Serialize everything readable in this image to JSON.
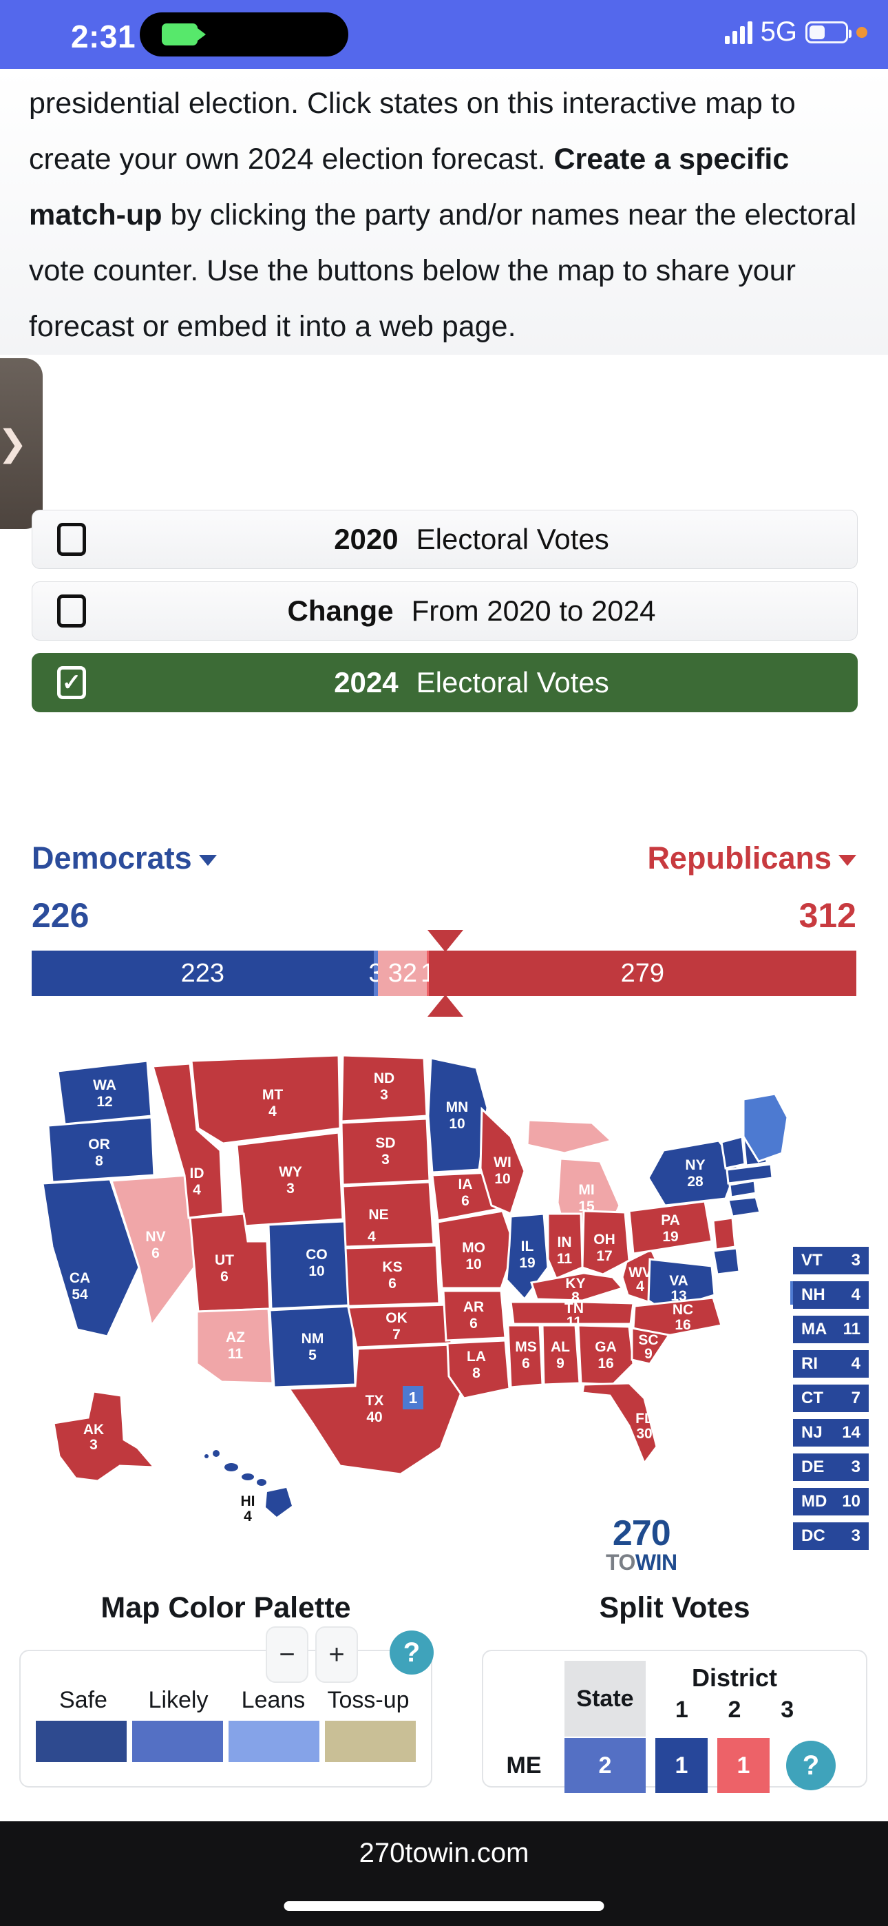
{
  "status_bar": {
    "time": "2:31",
    "network": "5G",
    "camera_icon": "video-camera-icon",
    "signal_icon": "cellular-bars-icon",
    "battery_icon": "battery-icon",
    "recording_dot_color": "#f09536",
    "background_color": "#5468ec"
  },
  "intro": {
    "paragraph_part1": "presidential election. Click states on this interactive map to create your own 2024 election forecast. ",
    "paragraph_bold": "Create a specific match-up",
    "paragraph_part2": " by clicking the party and/or names near the electoral vote counter. Use the buttons below the map to share your forecast or embed it into a web page."
  },
  "side_tab": {
    "icon": "chevron-right-icon",
    "glyph": "❯"
  },
  "toggles": [
    {
      "checked": false,
      "bold_label": "2020",
      "label": "Electoral Votes"
    },
    {
      "checked": false,
      "bold_label": "Change",
      "label": "From 2020 to 2024"
    },
    {
      "checked": true,
      "bold_label": "2024",
      "label": "Electoral Votes",
      "check_glyph": "✓"
    }
  ],
  "counter": {
    "dem_label": "Democrats",
    "rep_label": "Republicans",
    "dem_total": "226",
    "rep_total": "312",
    "dem_color": "#2b4c9b",
    "rep_color": "#c83a3f",
    "segments": [
      {
        "label": "223",
        "value": 223,
        "color": "#27479a"
      },
      {
        "label": "3",
        "value": 3,
        "color": "#5b7dd1"
      },
      {
        "label": "32",
        "value": 32,
        "color": "#f0a6a8"
      },
      {
        "label": "1",
        "value": 1,
        "color": "#ed6268"
      },
      {
        "label": "279",
        "value": 279,
        "color": "#c0393e"
      }
    ],
    "majority_marker": 270
  },
  "map": {
    "logo_line1": "270",
    "logo_to": "TO",
    "logo_win": "WIN",
    "colors": {
      "safe_dem": "#27479a",
      "likely_dem": "#4d7ad1",
      "leans_dem": "#85a3e8",
      "safe_rep": "#c0393e",
      "leans_rep": "#f0a6a8",
      "likely_rep": "#ed6268",
      "tossup": "#c9bf96"
    },
    "states": [
      {
        "abbr": "WA",
        "votes": "12",
        "party": "D"
      },
      {
        "abbr": "OR",
        "votes": "8",
        "party": "D"
      },
      {
        "abbr": "CA",
        "votes": "54",
        "party": "D"
      },
      {
        "abbr": "NV",
        "votes": "6",
        "party": "R-leans"
      },
      {
        "abbr": "ID",
        "votes": "4",
        "party": "R"
      },
      {
        "abbr": "MT",
        "votes": "4",
        "party": "R"
      },
      {
        "abbr": "WY",
        "votes": "3",
        "party": "R"
      },
      {
        "abbr": "UT",
        "votes": "6",
        "party": "R"
      },
      {
        "abbr": "AZ",
        "votes": "11",
        "party": "R-leans"
      },
      {
        "abbr": "NM",
        "votes": "5",
        "party": "D"
      },
      {
        "abbr": "CO",
        "votes": "10",
        "party": "D"
      },
      {
        "abbr": "ND",
        "votes": "3",
        "party": "R"
      },
      {
        "abbr": "SD",
        "votes": "3",
        "party": "R"
      },
      {
        "abbr": "NE",
        "votes": "4",
        "party": "R",
        "split_chip": "1",
        "split_party": "D"
      },
      {
        "abbr": "KS",
        "votes": "6",
        "party": "R"
      },
      {
        "abbr": "OK",
        "votes": "7",
        "party": "R"
      },
      {
        "abbr": "TX",
        "votes": "40",
        "party": "R"
      },
      {
        "abbr": "MN",
        "votes": "10",
        "party": "D"
      },
      {
        "abbr": "IA",
        "votes": "6",
        "party": "R"
      },
      {
        "abbr": "MO",
        "votes": "10",
        "party": "R"
      },
      {
        "abbr": "AR",
        "votes": "6",
        "party": "R"
      },
      {
        "abbr": "LA",
        "votes": "8",
        "party": "R"
      },
      {
        "abbr": "WI",
        "votes": "10",
        "party": "R"
      },
      {
        "abbr": "IL",
        "votes": "19",
        "party": "D"
      },
      {
        "abbr": "MI",
        "votes": "15",
        "party": "R-leans"
      },
      {
        "abbr": "IN",
        "votes": "11",
        "party": "R"
      },
      {
        "abbr": "OH",
        "votes": "17",
        "party": "R"
      },
      {
        "abbr": "KY",
        "votes": "8",
        "party": "R"
      },
      {
        "abbr": "TN",
        "votes": "11",
        "party": "R"
      },
      {
        "abbr": "MS",
        "votes": "6",
        "party": "R"
      },
      {
        "abbr": "AL",
        "votes": "9",
        "party": "R"
      },
      {
        "abbr": "GA",
        "votes": "16",
        "party": "R"
      },
      {
        "abbr": "SC",
        "votes": "9",
        "party": "R"
      },
      {
        "abbr": "NC",
        "votes": "16",
        "party": "R"
      },
      {
        "abbr": "FL",
        "votes": "30",
        "party": "R"
      },
      {
        "abbr": "WV",
        "votes": "4",
        "party": "R"
      },
      {
        "abbr": "VA",
        "votes": "13",
        "party": "D"
      },
      {
        "abbr": "PA",
        "votes": "19",
        "party": "R"
      },
      {
        "abbr": "NY",
        "votes": "28",
        "party": "D"
      },
      {
        "abbr": "ME",
        "votes": "",
        "party": "D-likely"
      },
      {
        "abbr": "AK",
        "votes": "3",
        "party": "R"
      },
      {
        "abbr": "HI",
        "votes": "4",
        "party": "D"
      }
    ],
    "me_chips": [
      {
        "label": "2",
        "color": "#4d7ad1"
      },
      {
        "label": "1",
        "color": "#ed6268"
      },
      {
        "label": "1",
        "color": "#27479a"
      }
    ],
    "me_label": "ME",
    "northeast_list": [
      {
        "abbr": "VT",
        "votes": "3"
      },
      {
        "abbr": "NH",
        "votes": "4"
      },
      {
        "abbr": "MA",
        "votes": "11"
      },
      {
        "abbr": "RI",
        "votes": "4"
      },
      {
        "abbr": "CT",
        "votes": "7"
      },
      {
        "abbr": "NJ",
        "votes": "14"
      },
      {
        "abbr": "DE",
        "votes": "3"
      },
      {
        "abbr": "MD",
        "votes": "10"
      },
      {
        "abbr": "DC",
        "votes": "3"
      }
    ]
  },
  "palette_panel": {
    "title": "Map Color Palette",
    "minus_label": "−",
    "plus_label": "+",
    "help_label": "?",
    "labels": [
      "Safe",
      "Likely",
      "Leans",
      "Toss-up"
    ],
    "swatches": [
      "#2e4a8f",
      "#5470c4",
      "#85a3e8",
      "#c9bf96"
    ]
  },
  "split_panel": {
    "title": "Split Votes",
    "state_header": "State",
    "district_header": "District",
    "district_numbers": [
      "1",
      "2",
      "3"
    ],
    "rows": [
      {
        "abbr": "ME",
        "state_value": "2",
        "state_color": "#5470c4",
        "districts": [
          {
            "value": "1",
            "color": "#27479a"
          },
          {
            "value": "1",
            "color": "#ed6268"
          },
          {
            "value": "?",
            "color": "#3fa3bb",
            "is_help": true
          }
        ]
      }
    ]
  },
  "bottom_bar": {
    "url": "270towin.com"
  }
}
